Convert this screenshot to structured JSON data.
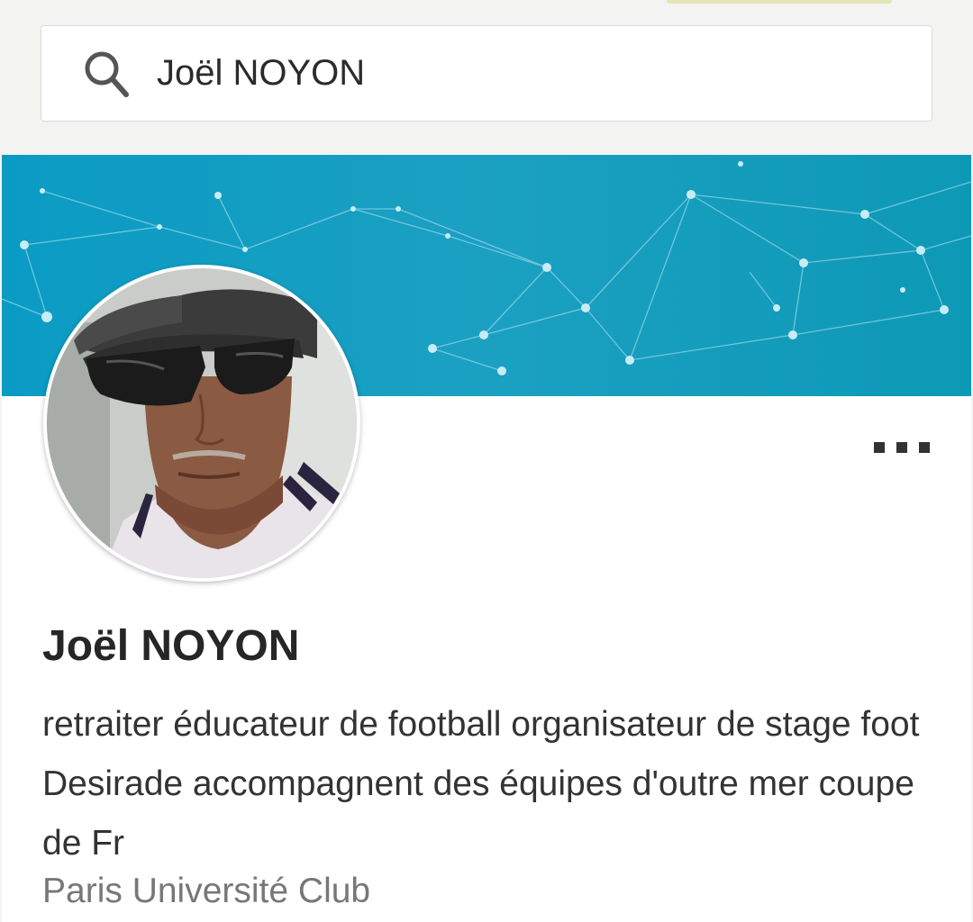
{
  "search": {
    "query": "Joël NOYON",
    "icon": "search-icon"
  },
  "profile": {
    "name": "Joël NOYON",
    "headline": "retraiter éducateur de football organisateur de stage foot Desirade accompagnent des équipes d'outre mer coupe de Fr",
    "organization": "Paris Université Club",
    "more_icon": "more-dots-icon"
  },
  "colors": {
    "banner": "#0a9bc4",
    "name_text": "#262626",
    "org_text": "#777777"
  }
}
